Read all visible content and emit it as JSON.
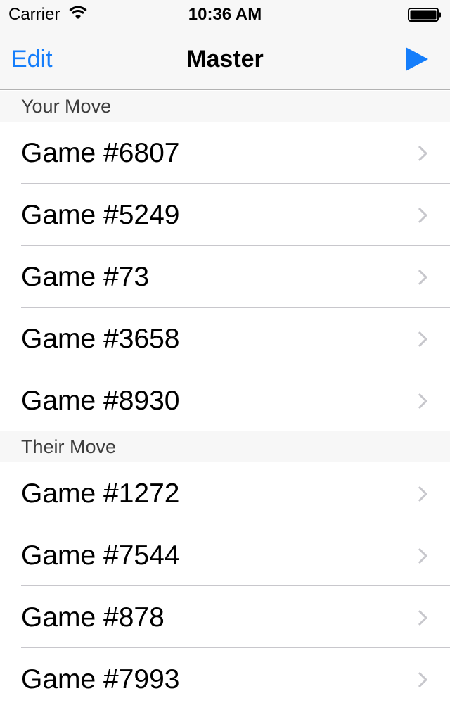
{
  "status_bar": {
    "carrier": "Carrier",
    "time": "10:36 AM"
  },
  "nav": {
    "left_button": "Edit",
    "title": "Master",
    "right_icon": "play-icon"
  },
  "sections": [
    {
      "header": "Your Move",
      "rows": [
        "Game #6807",
        "Game #5249",
        "Game #73",
        "Game #3658",
        "Game #8930"
      ]
    },
    {
      "header": "Their Move",
      "rows": [
        "Game #1272",
        "Game #7544",
        "Game #878",
        "Game #7993"
      ]
    }
  ],
  "colors": {
    "accent": "#157efb",
    "bar_background": "#f7f7f7",
    "separator": "#c8c7cc",
    "chevron": "#c7c7cc"
  }
}
